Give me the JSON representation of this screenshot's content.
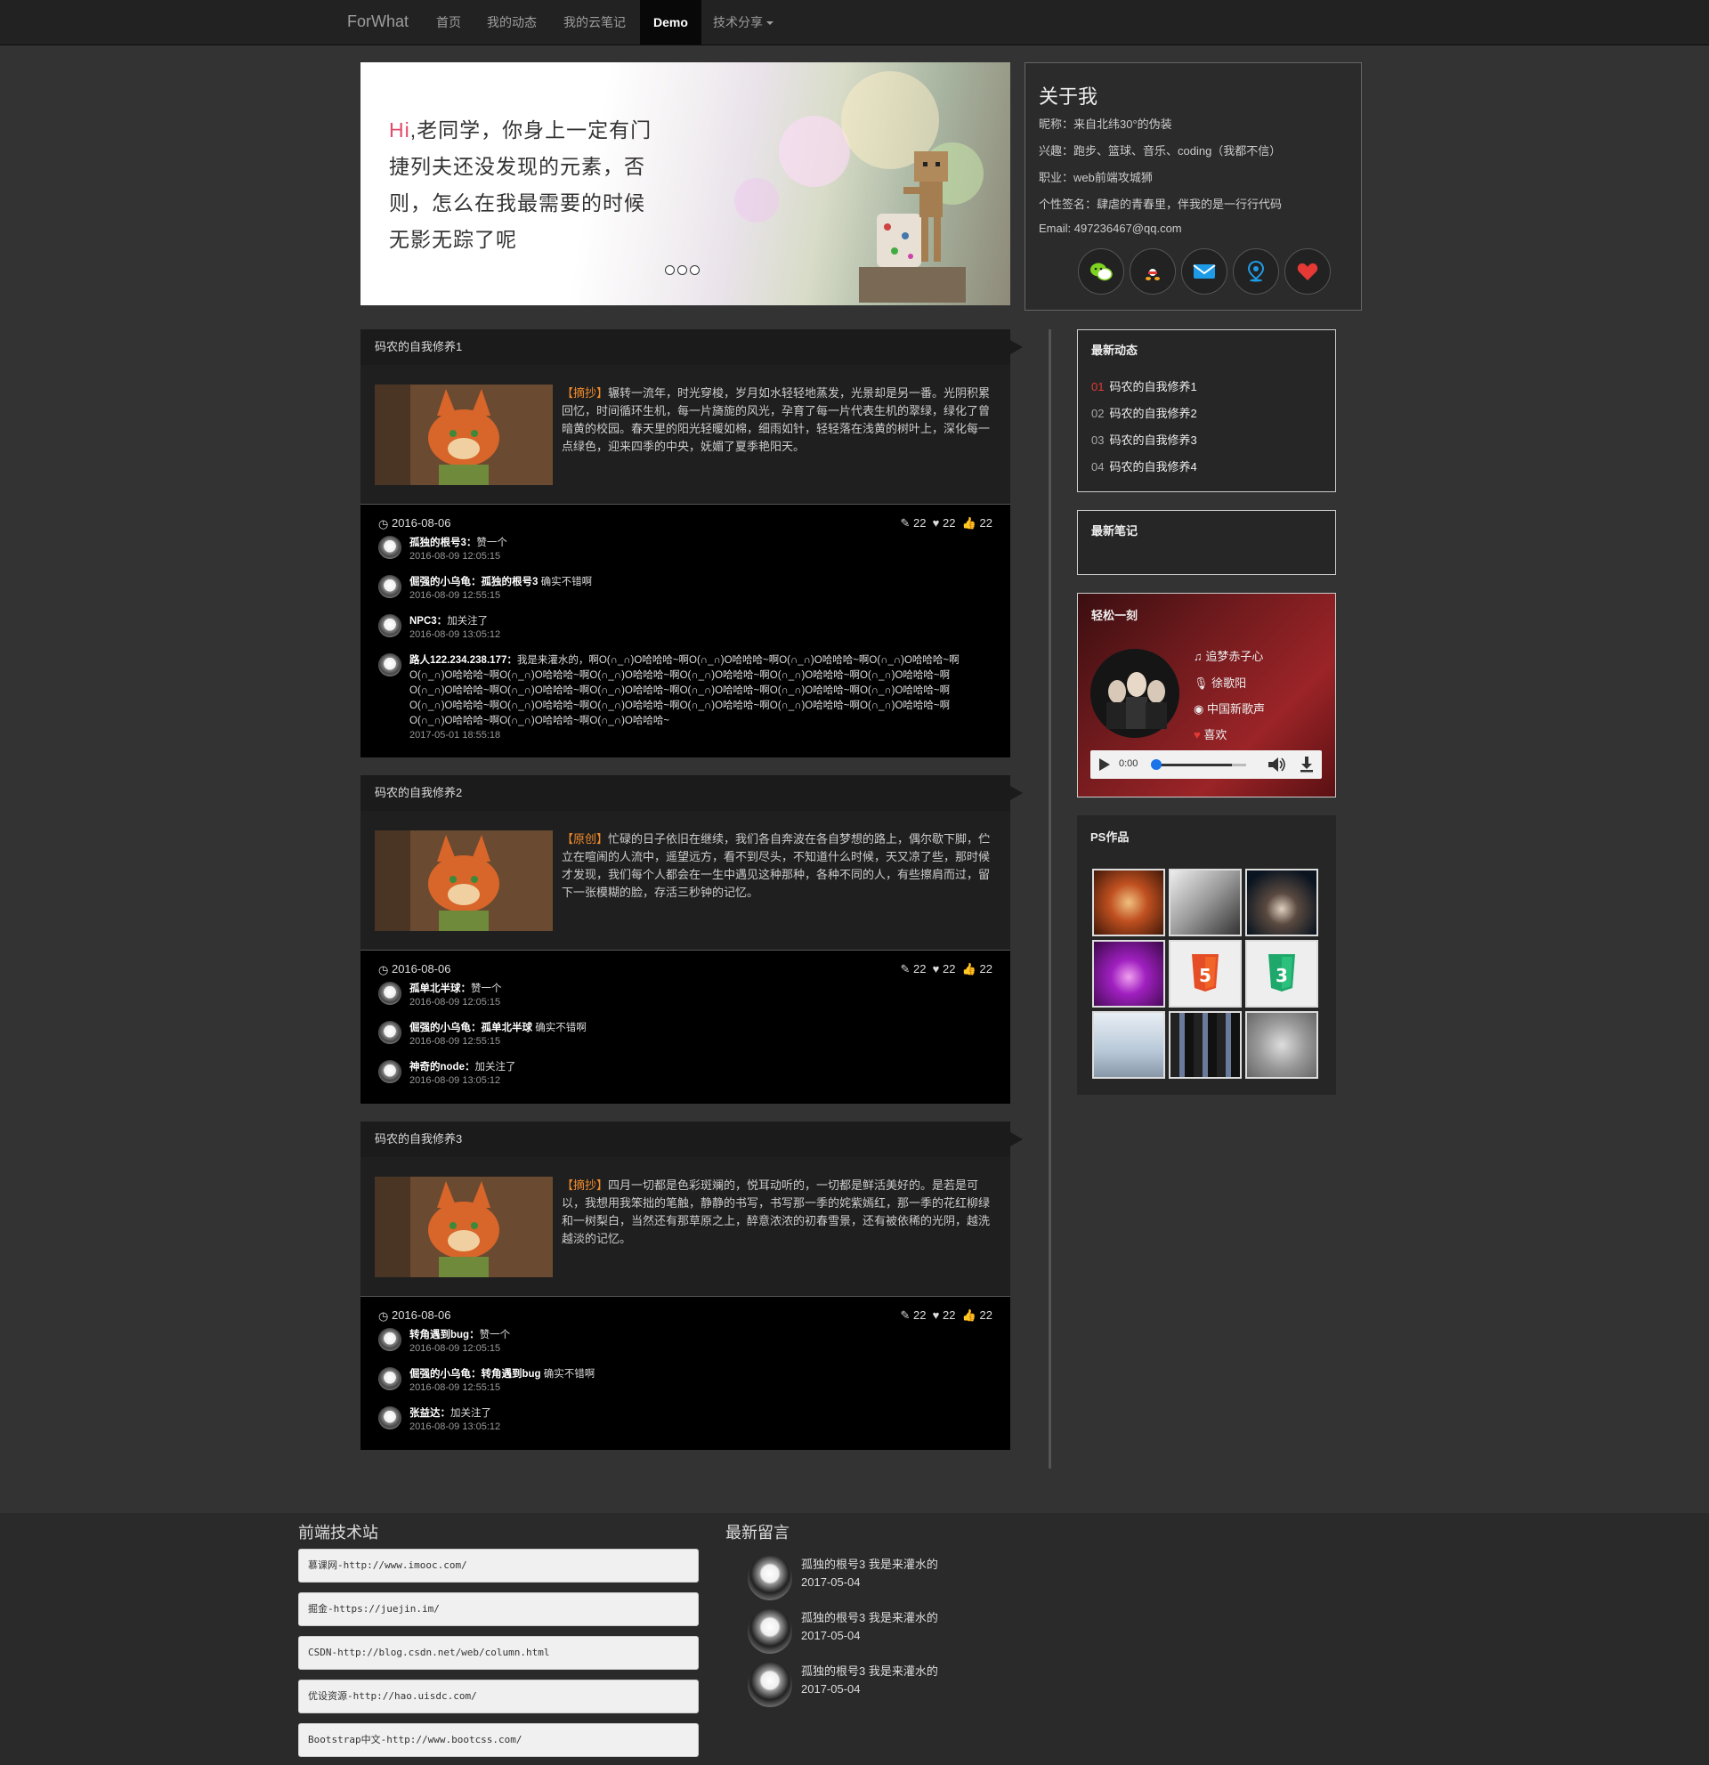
{
  "nav": {
    "brand": "ForWhat",
    "items": [
      "首页",
      "我的动态",
      "我的云笔记",
      "Demo",
      "技术分享"
    ],
    "active": "Demo"
  },
  "banner": {
    "hi": "Hi",
    "text": ",老同学，你身上一定有门捷列夫还没发现的元素，否则，怎么在我最需要的时候无影无踪了呢"
  },
  "about": {
    "title": "关于我",
    "nickname": "昵称：来自北纬30°的伪装",
    "hobby": "兴趣：跑步、篮球、音乐、coding（我都不信）",
    "job": "职业：web前端攻城狮",
    "signature": "个性签名：肆虐的青春里，伴我的是一行行代码",
    "email": "Email: 497236467@qq.com",
    "icons": [
      "wechat-icon",
      "qq-icon",
      "mail-icon",
      "location-icon",
      "heart-icon"
    ]
  },
  "articles": [
    {
      "title": "码农的自我修养1",
      "tag": "【摘抄】",
      "text": "辗转一流年，时光穿梭，岁月如水轻轻地蒸发，光景却是另一番。光阴积累回忆，时间循环生机，每一片旖旎的风光，孕育了每一片代表生机的翠绿，绿化了曾暗黄的校园。春天里的阳光轻暖如棉，细雨如针，轻轻落在浅黄的树叶上，深化每一点绿色，迎来四季的中央，妩媚了夏季艳阳天。",
      "date": "2016-08-06",
      "edits": "22",
      "likes": "22",
      "thumbs": "22",
      "comments": [
        {
          "user": "孤独的根号3：",
          "text": "赞一个",
          "time": "2016-08-09 12:05:15"
        },
        {
          "user": "倔强的小乌龟：孤独的根号3",
          "text": " 确实不错啊",
          "time": "2016-08-09 12:55:15"
        },
        {
          "user": "NPC3：",
          "text": "加关注了",
          "time": "2016-08-09 13:05:12"
        },
        {
          "user": "路人122.234.238.177：",
          "text": "我是来灌水的，啊O(∩_∩)O哈哈哈~啊O(∩_∩)O哈哈哈~啊O(∩_∩)O哈哈哈~啊O(∩_∩)O哈哈哈~啊O(∩_∩)O哈哈哈~啊O(∩_∩)O哈哈哈~啊O(∩_∩)O哈哈哈~啊O(∩_∩)O哈哈哈~啊O(∩_∩)O哈哈哈~啊O(∩_∩)O哈哈哈~啊O(∩_∩)O哈哈哈~啊O(∩_∩)O哈哈哈~啊O(∩_∩)O哈哈哈~啊O(∩_∩)O哈哈哈~啊O(∩_∩)O哈哈哈~啊O(∩_∩)O哈哈哈~啊O(∩_∩)O哈哈哈~啊O(∩_∩)O哈哈哈~啊O(∩_∩)O哈哈哈~啊O(∩_∩)O哈哈哈~啊O(∩_∩)O哈哈哈~啊O(∩_∩)O哈哈哈~啊O(∩_∩)O哈哈哈~啊O(∩_∩)O哈哈哈~啊O(∩_∩)O哈哈哈~",
          "time": "2017-05-01 18:55:18"
        }
      ]
    },
    {
      "title": "码农的自我修养2",
      "tag": "【原创】",
      "text": "忙碌的日子依旧在继续，我们各自奔波在各自梦想的路上，偶尔歇下脚，伫立在喧闹的人流中，遥望远方，看不到尽头，不知道什么时候，天又凉了些，那时候才发现，我们每个人都会在一生中遇见这种那种，各种不同的人，有些擦肩而过，留下一张模糊的脸，存活三秒钟的记忆。",
      "date": "2016-08-06",
      "edits": "22",
      "likes": "22",
      "thumbs": "22",
      "comments": [
        {
          "user": "孤单北半球：",
          "text": "赞一个",
          "time": "2016-08-09 12:05:15"
        },
        {
          "user": "倔强的小乌龟：孤单北半球",
          "text": " 确实不错啊",
          "time": "2016-08-09 12:55:15"
        },
        {
          "user": "神奇的node：",
          "text": "加关注了",
          "time": "2016-08-09 13:05:12"
        }
      ]
    },
    {
      "title": "码农的自我修养3",
      "tag": "【摘抄】",
      "text": "四月一切都是色彩斑斓的，悦耳动听的，一切都是鲜活美好的。是若是可以，我想用我笨拙的笔触，静静的书写，书写那一季的姹紫嫣红，那一季的花红柳绿和一树梨白，当然还有那草原之上，醉意浓浓的初春雪景，还有被依稀的光阴，越洗越淡的记忆。",
      "date": "2016-08-06",
      "edits": "22",
      "likes": "22",
      "thumbs": "22",
      "comments": [
        {
          "user": "转角遇到bug：",
          "text": "赞一个",
          "time": "2016-08-09 12:05:15"
        },
        {
          "user": "倔强的小乌龟：转角遇到bug",
          "text": " 确实不错啊",
          "time": "2016-08-09 12:55:15"
        },
        {
          "user": "张益达：",
          "text": "加关注了",
          "time": "2016-08-09 13:05:12"
        }
      ]
    }
  ],
  "sidebar": {
    "latest_title": "最新动态",
    "latest": [
      {
        "num": "01",
        "title": "码农的自我修养1"
      },
      {
        "num": "02",
        "title": "码农的自我修养2"
      },
      {
        "num": "03",
        "title": "码农的自我修养3"
      },
      {
        "num": "04",
        "title": "码农的自我修养4"
      }
    ],
    "notes_title": "最新笔记",
    "music_title": "轻松一刻",
    "song": "追梦赤子心",
    "singer": "徐歌阳",
    "album": "中国新歌声",
    "fav": "喜欢",
    "time": "0:00",
    "progress": 0.0,
    "volume": 0.85,
    "ps_title": "PS作品"
  },
  "footer": {
    "links_title": "前端技术站",
    "links": [
      "慕课网-http://www.imooc.com/",
      "掘金-https://juejin.im/",
      "CSDN-http://blog.csdn.net/web/column.html",
      "优设资源-http://hao.uisdc.com/",
      "Bootstrap中文-http://www.bootcss.com/"
    ],
    "msg_title": "最新留言",
    "messages": [
      {
        "text": "孤独的根号3 我是来灌水的",
        "date": "2017-05-04"
      },
      {
        "text": "孤独的根号3 我是来灌水的",
        "date": "2017-05-04"
      },
      {
        "text": "孤独的根号3 我是来灌水的",
        "date": "2017-05-04"
      }
    ]
  },
  "colors": {
    "accent": "#f08a2b",
    "highlight": "#e24b6a",
    "rank1": "#e53935"
  }
}
